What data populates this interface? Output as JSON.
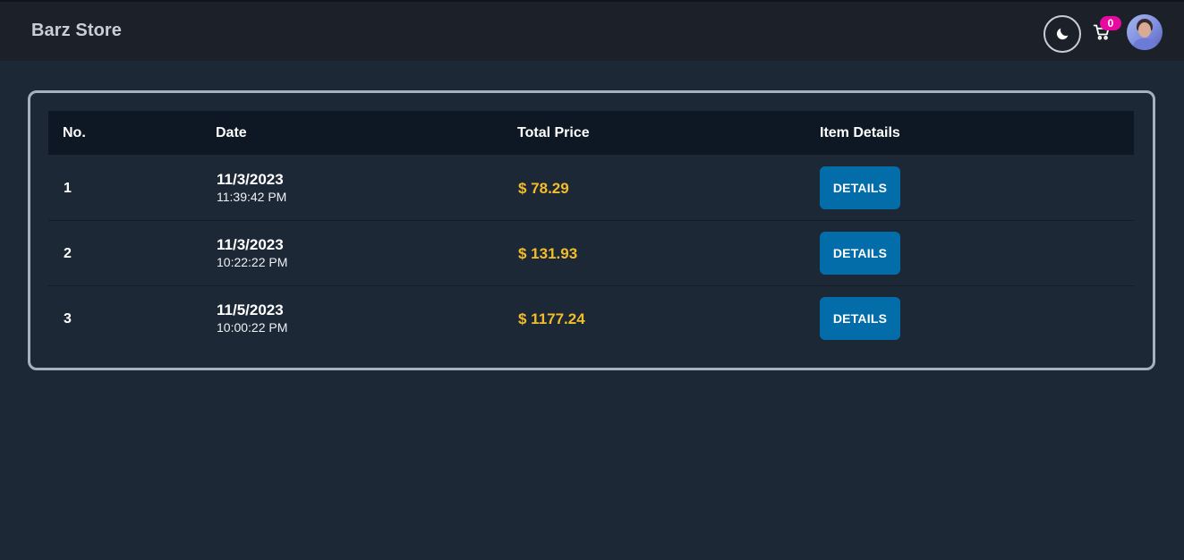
{
  "navbar": {
    "brand": "Barz Store",
    "theme_icon": "moon-icon",
    "cart_icon": "cart-icon",
    "cart_count": "0",
    "avatar_icon": "user-avatar"
  },
  "colors": {
    "background": "#1d2836",
    "navbar": "#1b2029",
    "table_header": "#0e1724",
    "price": "#f2bd2a",
    "button": "#036daa",
    "badge": "#e60aa0"
  },
  "table": {
    "headers": {
      "no": "No.",
      "date": "Date",
      "total_price": "Total Price",
      "item_details": "Item Details"
    },
    "rows": [
      {
        "no": "1",
        "date": "11/3/2023",
        "time": "11:39:42 PM",
        "price": "$ 78.29",
        "button": "DETAILS"
      },
      {
        "no": "2",
        "date": "11/3/2023",
        "time": "10:22:22 PM",
        "price": "$ 131.93",
        "button": "DETAILS"
      },
      {
        "no": "3",
        "date": "11/5/2023",
        "time": "10:00:22 PM",
        "price": "$ 1177.24",
        "button": "DETAILS"
      }
    ]
  }
}
